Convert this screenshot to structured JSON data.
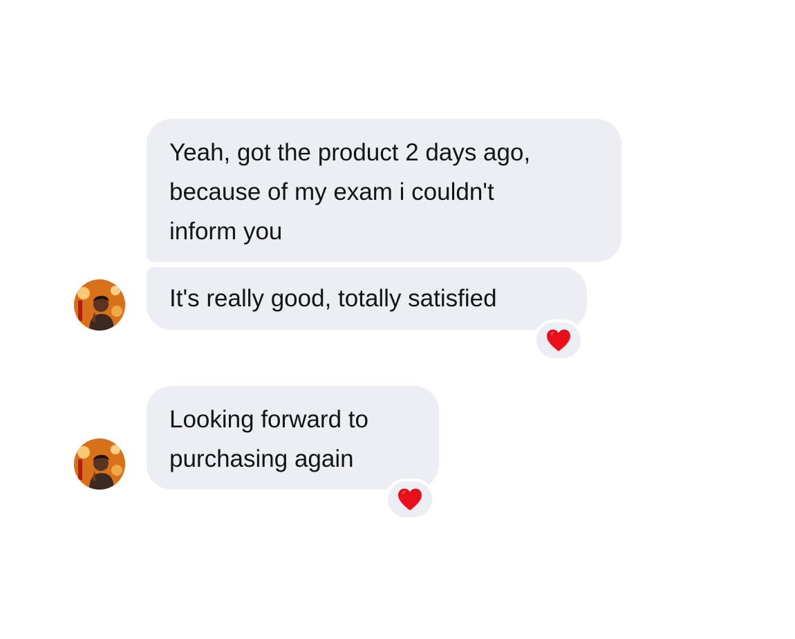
{
  "conversation": {
    "messages": [
      {
        "text": "Yeah, got the product 2 days ago,\nbecause of my exam i couldn't\ninform you",
        "reaction": null
      },
      {
        "text": "It's really good, totally satisfied",
        "reaction": "heart"
      },
      {
        "text": "Looking forward to\npurchasing again",
        "reaction": "heart"
      }
    ],
    "reaction_color": "#e8101a",
    "bubble_color": "#eceef3",
    "avatar_icon": "user-photo"
  }
}
